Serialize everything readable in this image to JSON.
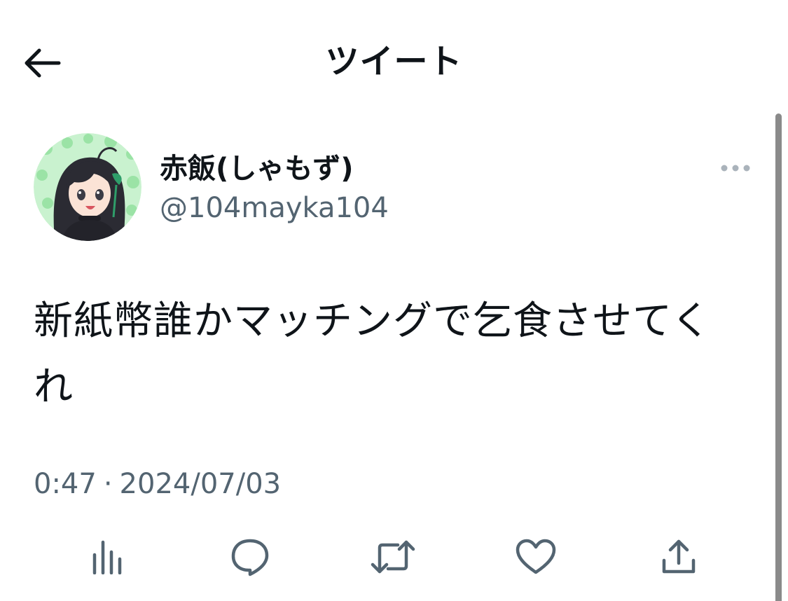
{
  "header": {
    "title": "ツイート",
    "back_icon": "arrow-left-icon"
  },
  "tweet": {
    "author": {
      "display_name": "赤飯(しゃもず)",
      "handle": "@104mayka104",
      "avatar": "avatar-image"
    },
    "more_icon": "more-horizontal-icon",
    "text": "新紙幣誰かマッチングで乞食させてくれ",
    "time": "0:47",
    "separator": "·",
    "date": "2024/07/03",
    "actions": [
      {
        "name": "view-count-button",
        "icon": "bar-chart-icon"
      },
      {
        "name": "reply-button",
        "icon": "reply-icon"
      },
      {
        "name": "retweet-button",
        "icon": "retweet-icon"
      },
      {
        "name": "like-button",
        "icon": "heart-icon"
      },
      {
        "name": "share-button",
        "icon": "share-icon"
      }
    ]
  },
  "colors": {
    "text_primary": "#0f1419",
    "text_secondary": "#536471",
    "background": "#ffffff",
    "avatar_bg": "#b8eec0",
    "scrollbar": "#8a8a8a"
  }
}
